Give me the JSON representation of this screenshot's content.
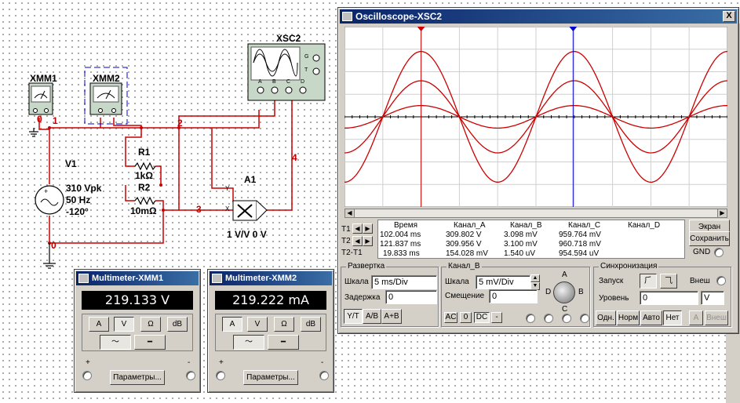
{
  "schematic": {
    "xmm1_label": "XMM1",
    "xmm2_label": "XMM2",
    "xsc2_label": "XSC2",
    "scope_pins": [
      "A",
      "B",
      "C",
      "D"
    ],
    "scope_tg": [
      "G",
      "T"
    ],
    "v1_label": "V1",
    "v1_params": [
      "310 Vpk",
      "50 Hz",
      "-120°"
    ],
    "r1_label": "R1",
    "r1_value": "1kΩ",
    "r2_label": "R2",
    "r2_value": "10mΩ",
    "a1_label": "A1",
    "a1_value": "1 V/V 0 V",
    "a1_pin_y": "Y",
    "a1_pin_x": "X",
    "nodes": [
      "0",
      "1",
      "2",
      "3",
      "4",
      "0"
    ],
    "pins": [
      "+",
      "-"
    ]
  },
  "oscilloscope": {
    "title": "Oscilloscope-XSC2",
    "close": "X",
    "cursor_t1": "T1",
    "cursor_t2": "T2",
    "cursor_t2t1": "T2-T1",
    "table_headers": [
      "Время",
      "Канал_A",
      "Канал_B",
      "Канал_C",
      "Канал_D"
    ],
    "rows": [
      [
        "102.004 ms",
        "309.802 V",
        "3.098 mV",
        "959.764 mV",
        ""
      ],
      [
        "121.837 ms",
        "309.956 V",
        "3.100 mV",
        "960.718 mV",
        ""
      ],
      [
        "19.833 ms",
        "154.028 mV",
        "1.540 uV",
        "954.594 uV",
        ""
      ]
    ],
    "btn_screen": "Экран",
    "btn_save": "Сохранить",
    "gnd": "GND",
    "timebase": {
      "title": "Развертка",
      "scale_label": "Шкала",
      "scale_value": "5 ms/Div",
      "delay_label": "Задержка",
      "delay_value": "0",
      "modes": [
        "Y/T",
        "A/B",
        "A+B"
      ]
    },
    "channel_b": {
      "title": "Канал_B",
      "scale_label": "Шкала",
      "scale_value": "5 mV/Div",
      "offset_label": "Смещение",
      "offset_value": "0",
      "coupling": [
        "AC",
        "0",
        "DC",
        "-"
      ]
    },
    "selector": [
      "A",
      "B",
      "C",
      "D"
    ],
    "trigger": {
      "title": "Синхронизация",
      "launch_label": "Запуск",
      "ext_label": "Внеш",
      "level_label": "Уровень",
      "level_value": "0",
      "level_unit": "V",
      "modes": [
        "Одн.",
        "Норм",
        "Авто",
        "Нет"
      ],
      "ext_btn": "A",
      "ext_btn2": "Внеш"
    }
  },
  "xmm1": {
    "title": "Multimeter-XMM1",
    "reading": "219.133 V",
    "modes": [
      "A",
      "V",
      "Ω",
      "dB"
    ],
    "params_button": "Параметры...",
    "plus": "+",
    "minus": "-"
  },
  "xmm2": {
    "title": "Multimeter-XMM2",
    "reading": "219.222 mA",
    "modes": [
      "A",
      "V",
      "Ω",
      "dB"
    ],
    "params_button": "Параметры...",
    "plus": "+",
    "minus": "-"
  },
  "colors": {
    "wire": "#cc0000",
    "trace": "#cc0000",
    "cursor1": "#cc0000",
    "cursor2": "#0000cc",
    "titlebar": "#0a246a"
  },
  "scope_traces": {
    "amplitudes_div": [
      2.9,
      1.6,
      0.5
    ],
    "phase_shift_div": [
      0,
      0,
      0
    ],
    "period_div": 4.0,
    "t1_div": 2.0,
    "t2_div": 5.97
  }
}
